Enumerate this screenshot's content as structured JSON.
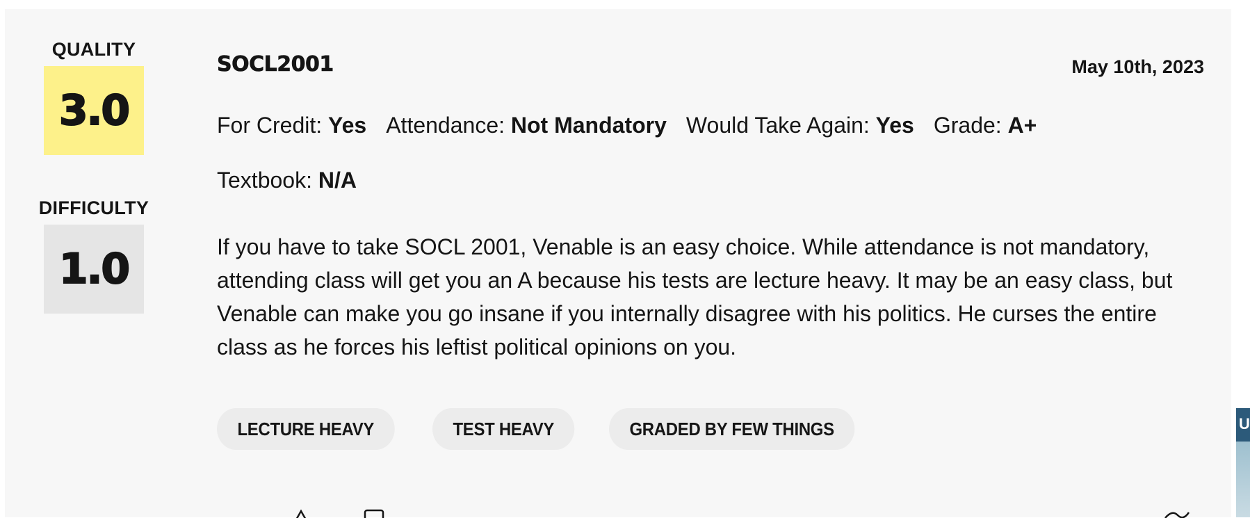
{
  "ratings": {
    "quality": {
      "label": "QUALITY",
      "value": "3.0",
      "color": "#fdf18a"
    },
    "difficulty": {
      "label": "DIFFICULTY",
      "value": "1.0",
      "color": "#e5e5e5"
    }
  },
  "review": {
    "course": "SOCL2001",
    "date": "May 10th, 2023",
    "meta": [
      {
        "label": "For Credit:",
        "value": "Yes"
      },
      {
        "label": "Attendance:",
        "value": "Not Mandatory"
      },
      {
        "label": "Would Take Again:",
        "value": "Yes"
      },
      {
        "label": "Grade:",
        "value": "A+"
      }
    ],
    "textbook": {
      "label": "Textbook:",
      "value": "N/A"
    },
    "text": "If you have to take SOCL 2001, Venable is an easy choice. While attendance is not mandatory, attending class will get you an A because his tests are lecture heavy. It may be an easy class, but Venable can make you go insane if you internally disagree with his politics. He curses the entire class as he forces his leftist political opinions on you.",
    "tags": [
      "LECTURE HEAVY",
      "TEST HEAVY",
      "GRADED BY FEW THINGS"
    ]
  },
  "footer_icons": [
    "thumbs-up-icon",
    "thumbs-down-icon",
    "flag-icon"
  ],
  "side_widget": {
    "letter": "U"
  }
}
